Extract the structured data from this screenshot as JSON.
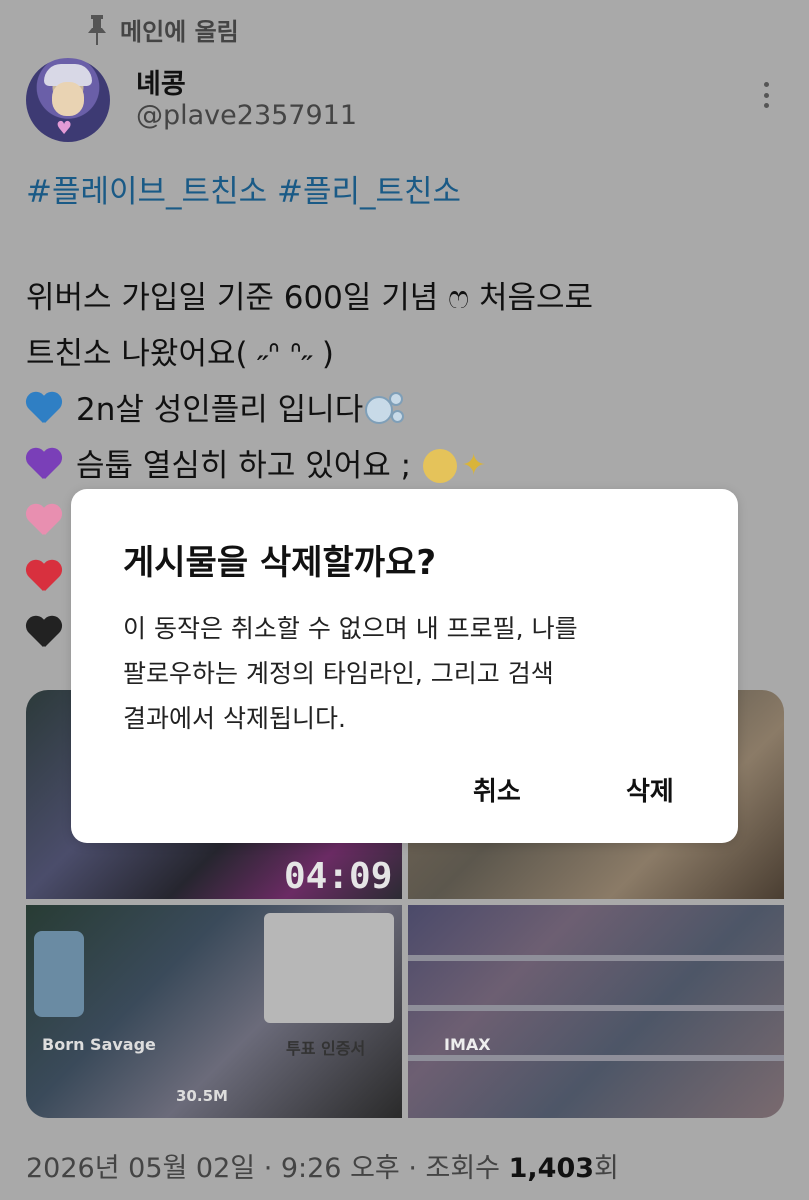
{
  "pinned": {
    "label": "메인에 올림"
  },
  "author": {
    "name": "녜콩",
    "handle": "@plave2357911"
  },
  "post": {
    "hashtags": "#플레이브_트친소 #플리_트친소",
    "lines": [
      "위버스 가입일 기준 600일 기념 ෆ 처음으로",
      "트친소 나왔어요( ˶ᐢ ᐢ˶ )",
      "2n살 성인플리 입니다",
      "슴툽 열심히 하고 있어요 ;"
    ],
    "heart_colors": [
      "#2f7fc4",
      "#7a3fb8",
      "#e88fb0",
      "#d8303e",
      "#222222"
    ]
  },
  "media": {
    "clock_text": "04:09",
    "album_title": "Born Savage",
    "stream_count": "30.5M",
    "vote_text": "투표 인증서",
    "imax_text": "IMAX"
  },
  "meta": {
    "timestamp": "2026년 05월 02일 · 9:26 오후 · 조회수 ",
    "views": "1,403",
    "views_suffix": "회"
  },
  "dialog": {
    "title": "게시물을 삭제할까요?",
    "message_lines": [
      "이 동작은 취소할 수 없으며 내 프로필, 나를",
      "팔로우하는 계정의 타임라인, 그리고 검색",
      "결과에서 삭제됩니다."
    ],
    "cancel_label": "취소",
    "delete_label": "삭제"
  }
}
